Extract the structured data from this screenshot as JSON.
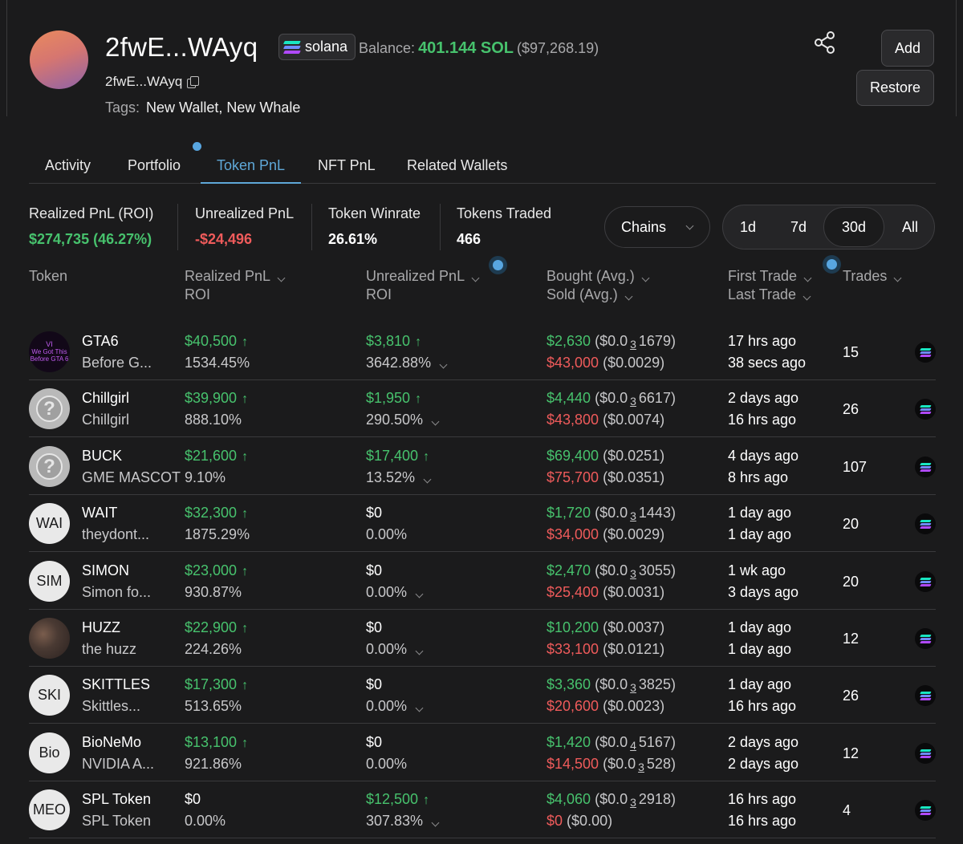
{
  "wallet": {
    "title": "2fwE...WAyq",
    "address": "2fwE...WAyq",
    "chain": "solana",
    "balance_label": "Balance:",
    "balance_sol": "401.144 SOL",
    "balance_usd": "($97,268.19)",
    "tags_label": "Tags:",
    "tags": "New Wallet, New Whale"
  },
  "actions": {
    "add": "Add",
    "restore": "Restore"
  },
  "tabs": [
    {
      "label": "Activity"
    },
    {
      "label": "Portfolio"
    },
    {
      "label": "Token PnL"
    },
    {
      "label": "NFT PnL"
    },
    {
      "label": "Related Wallets"
    }
  ],
  "active_tab": "Token PnL",
  "stats": {
    "realized": {
      "label": "Realized PnL (ROI)",
      "value": "$274,735 (46.27%)"
    },
    "unrealized": {
      "label": "Unrealized PnL",
      "value": "-$24,496"
    },
    "winrate": {
      "label": "Token Winrate",
      "value": "26.61%"
    },
    "traded": {
      "label": "Tokens Traded",
      "value": "466"
    }
  },
  "filters": {
    "chains": "Chains",
    "ranges": [
      "1d",
      "7d",
      "30d",
      "All"
    ],
    "selected_range": "30d"
  },
  "columns": {
    "token": "Token",
    "realized": "Realized PnL",
    "realized_sub": "ROI",
    "unrealized": "Unrealized PnL",
    "unrealized_sub": "ROI",
    "bought": "Bought (Avg.)",
    "sold": "Sold (Avg.)",
    "first": "First Trade",
    "last": "Last Trade",
    "trades": "Trades"
  },
  "rows": [
    {
      "symbol": "GTA6",
      "name": "Before G...",
      "avatar": "We Got This Before GTA 6",
      "realized": "$40,500",
      "realized_roi": "1534.45%",
      "unrealized": "$3,810",
      "unrealized_roi": "3642.88%",
      "bought": "$2,630",
      "bought_avg_pre": "($0.0",
      "bought_avg_sub": "3",
      "bought_avg_post": "1679)",
      "sold": "$43,000",
      "sold_avg_pre": "($0.0029)",
      "sold_avg_sub": "",
      "sold_avg_post": "",
      "first": "17 hrs ago",
      "last": "38 secs ago",
      "trades": "15"
    },
    {
      "symbol": "Chillgirl",
      "name": "Chillgirl",
      "avatar": "?",
      "realized": "$39,900",
      "realized_roi": "888.10%",
      "unrealized": "$1,950",
      "unrealized_roi": "290.50%",
      "bought": "$4,440",
      "bought_avg_pre": "($0.0",
      "bought_avg_sub": "3",
      "bought_avg_post": "6617)",
      "sold": "$43,800",
      "sold_avg_pre": "($0.0074)",
      "sold_avg_sub": "",
      "sold_avg_post": "",
      "first": "2 days ago",
      "last": "16 hrs ago",
      "trades": "26"
    },
    {
      "symbol": "BUCK",
      "name": "GME MASCOT",
      "avatar": "?",
      "realized": "$21,600",
      "realized_roi": "9.10%",
      "unrealized": "$17,400",
      "unrealized_roi": "13.52%",
      "bought": "$69,400",
      "bought_avg_pre": "($0.0251)",
      "bought_avg_sub": "",
      "bought_avg_post": "",
      "sold": "$75,700",
      "sold_avg_pre": "($0.0351)",
      "sold_avg_sub": "",
      "sold_avg_post": "",
      "first": "4 days ago",
      "last": "8 hrs ago",
      "trades": "107"
    },
    {
      "symbol": "WAIT",
      "name": "theydont...",
      "avatar": "WAI",
      "realized": "$32,300",
      "realized_roi": "1875.29%",
      "unrealized": "$0",
      "unrealized_roi": "0.00%",
      "bought": "$1,720",
      "bought_avg_pre": "($0.0",
      "bought_avg_sub": "3",
      "bought_avg_post": "1443)",
      "sold": "$34,000",
      "sold_avg_pre": "($0.0029)",
      "sold_avg_sub": "",
      "sold_avg_post": "",
      "first": "1 day ago",
      "last": "1 day ago",
      "trades": "20"
    },
    {
      "symbol": "SIMON",
      "name": "Simon fo...",
      "avatar": "SIM",
      "realized": "$23,000",
      "realized_roi": "930.87%",
      "unrealized": "$0",
      "unrealized_roi": "0.00%",
      "bought": "$2,470",
      "bought_avg_pre": "($0.0",
      "bought_avg_sub": "3",
      "bought_avg_post": "3055)",
      "sold": "$25,400",
      "sold_avg_pre": "($0.0031)",
      "sold_avg_sub": "",
      "sold_avg_post": "",
      "first": "1 wk ago",
      "last": "3 days ago",
      "trades": "20"
    },
    {
      "symbol": "HUZZ",
      "name": "the huzz",
      "avatar": "",
      "realized": "$22,900",
      "realized_roi": "224.26%",
      "unrealized": "$0",
      "unrealized_roi": "0.00%",
      "bought": "$10,200",
      "bought_avg_pre": "($0.0037)",
      "bought_avg_sub": "",
      "bought_avg_post": "",
      "sold": "$33,100",
      "sold_avg_pre": "($0.0121)",
      "sold_avg_sub": "",
      "sold_avg_post": "",
      "first": "1 day ago",
      "last": "1 day ago",
      "trades": "12"
    },
    {
      "symbol": "SKITTLES",
      "name": "Skittles...",
      "avatar": "SKI",
      "realized": "$17,300",
      "realized_roi": "513.65%",
      "unrealized": "$0",
      "unrealized_roi": "0.00%",
      "bought": "$3,360",
      "bought_avg_pre": "($0.0",
      "bought_avg_sub": "3",
      "bought_avg_post": "3825)",
      "sold": "$20,600",
      "sold_avg_pre": "($0.0023)",
      "sold_avg_sub": "",
      "sold_avg_post": "",
      "first": "1 day ago",
      "last": "16 hrs ago",
      "trades": "26"
    },
    {
      "symbol": "BioNeMo",
      "name": "NVIDIA A...",
      "avatar": "Bio",
      "realized": "$13,100",
      "realized_roi": "921.86%",
      "unrealized": "$0",
      "unrealized_roi": "0.00%",
      "bought": "$1,420",
      "bought_avg_pre": "($0.0",
      "bought_avg_sub": "4",
      "bought_avg_post": "5167)",
      "sold": "$14,500",
      "sold_avg_pre": "($0.0",
      "sold_avg_sub": "3",
      "sold_avg_post": "528)",
      "first": "2 days ago",
      "last": "2 days ago",
      "trades": "12"
    },
    {
      "symbol": "SPL Token",
      "name": "SPL Token",
      "avatar": "MEO",
      "realized": "$0",
      "realized_roi": "0.00%",
      "unrealized": "$12,500",
      "unrealized_roi": "307.83%",
      "bought": "$4,060",
      "bought_avg_pre": "($0.0",
      "bought_avg_sub": "3",
      "bought_avg_post": "2918)",
      "sold": "$0",
      "sold_avg_pre": "($0.00)",
      "sold_avg_sub": "",
      "sold_avg_post": "",
      "first": "16 hrs ago",
      "last": "16 hrs ago",
      "trades": "4"
    }
  ],
  "colors": {
    "positive": "#47c26d",
    "negative": "#ef5b5b",
    "accent": "#5fa8d8",
    "background": "#1b1b1c"
  },
  "icons": {
    "share": "share-icon",
    "copy": "copy-icon",
    "chain": "solana-icon",
    "sort": "chevron-down-icon",
    "up": "arrow-up-icon"
  }
}
